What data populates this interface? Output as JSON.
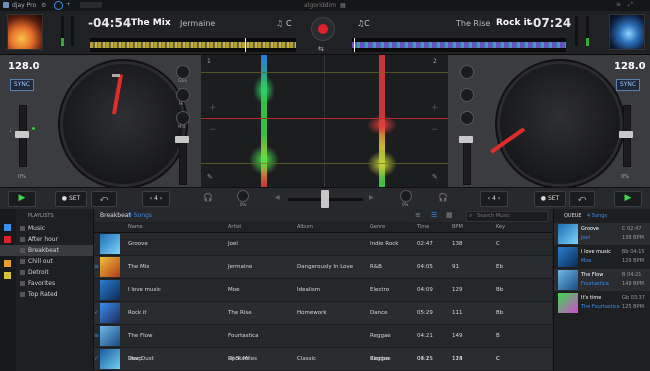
{
  "titlebar": {
    "app": "djay Pro",
    "center": "algoriddim"
  },
  "deck_left": {
    "time": "-04:54",
    "title": "The Mix",
    "artist": "Jermaine",
    "bpm": "128.0",
    "sync": "SYNC",
    "pitch": "0%",
    "key": "C",
    "color": "#e02b2b"
  },
  "deck_right": {
    "time": "-07:24",
    "title": "Rock it",
    "artist": "The Rise",
    "bpm": "128.0",
    "sync": "SYNC",
    "pitch": "0%",
    "color": "#e02b2b"
  },
  "center": {
    "marker_left": "1",
    "marker_right": "2",
    "eq_labels": [
      "Gain",
      "Hi",
      "Mid",
      "Lo"
    ]
  },
  "transport": {
    "set_left": "SET",
    "set_right": "SET",
    "loop_left": "4",
    "loop_right": "4",
    "filter_left": "0%",
    "filter_right": "0%"
  },
  "sidebar": {
    "header": "PLAYLISTS",
    "items": [
      "Music",
      "After hour",
      "Breakbeat",
      "Chill out",
      "Detroit",
      "Favorites",
      "Top Rated"
    ],
    "selected_index": 2
  },
  "library": {
    "playlist_name": "Breakbeat",
    "count_label": "9 Songs",
    "search_placeholder": "Search Music",
    "columns": [
      "Name",
      "Artist",
      "Album",
      "Genre",
      "Time",
      "BPM",
      "Key"
    ],
    "rows": [
      {
        "name": "Groove",
        "artist": "Joel",
        "album": "",
        "genre": "Indie Rock",
        "time": "02:47",
        "bpm": "138",
        "key": "C"
      },
      {
        "name": "The Mix",
        "artist": "Jermaine",
        "album": "Dangerously In Love",
        "genre": "R&B",
        "time": "04:05",
        "bpm": "91",
        "key": "Eb"
      },
      {
        "name": "I love music",
        "artist": "Moe",
        "album": "Idealism",
        "genre": "Electro",
        "time": "04:09",
        "bpm": "129",
        "key": "Bb"
      },
      {
        "name": "Rock it",
        "artist": "The Rise",
        "album": "Homework",
        "genre": "Dance",
        "time": "05:29",
        "bpm": "111",
        "key": "Bb"
      },
      {
        "name": "The Flow",
        "artist": "Fourtastica",
        "album": "",
        "genre": "Reggae",
        "time": "04:21",
        "bpm": "149",
        "key": "B"
      },
      {
        "name": "Star Dust",
        "artist": "DJ Starr",
        "album": "Classic",
        "genre": "Electro",
        "time": "04:25",
        "bpm": "113",
        "key": "C"
      },
      {
        "name": "Deep",
        "artist": "Rock Miles",
        "album": "",
        "genre": "Reggae",
        "time": "03:15",
        "bpm": "124",
        "key": "C"
      }
    ]
  },
  "queue": {
    "header": "QUEUE",
    "count_label": "4 Songs",
    "items": [
      {
        "title": "Groove",
        "artist": "Joel",
        "time": "C 02:47",
        "bpm": "138 BPM"
      },
      {
        "title": "I love music",
        "artist": "Moe",
        "time": "Bb 04:15",
        "bpm": "129 BPM"
      },
      {
        "title": "The Flow",
        "artist": "Fourtastica",
        "time": "B 04:21",
        "bpm": "149 BPM"
      },
      {
        "title": "It's time",
        "artist": "The Fourtastica",
        "time": "Gb 03:37",
        "bpm": "125 BPM"
      }
    ]
  }
}
